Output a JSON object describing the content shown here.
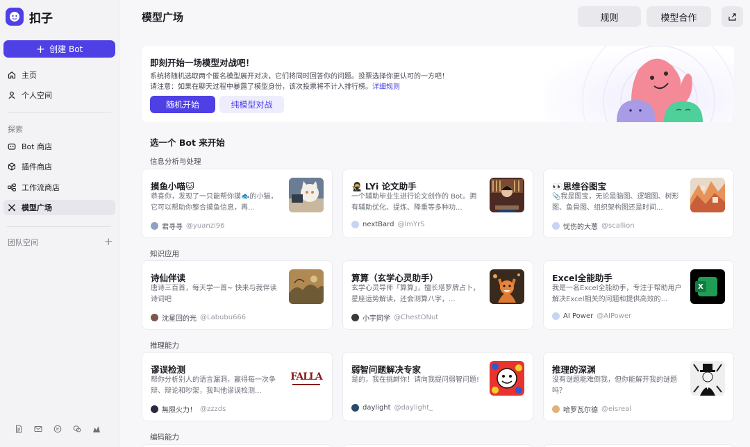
{
  "app": {
    "name": "扣子"
  },
  "sidebar": {
    "create_label": "创建 Bot",
    "nav": [
      {
        "label": "主页",
        "icon": "home-icon"
      },
      {
        "label": "个人空间",
        "icon": "person-icon"
      }
    ],
    "explore_label": "探索",
    "explore": [
      {
        "label": "Bot 商店",
        "icon": "bot-icon"
      },
      {
        "label": "插件商店",
        "icon": "cube-icon"
      },
      {
        "label": "工作流商店",
        "icon": "workflow-icon"
      },
      {
        "label": "模型广场",
        "icon": "model-arena-icon",
        "active": true
      }
    ],
    "team_label": "团队空间"
  },
  "header": {
    "title": "模型广场",
    "rules_label": "规则",
    "cooperation_label": "模型合作"
  },
  "banner": {
    "title": "即刻开始一场模型对战吧！",
    "line1": "系统将随机选取两个匿名模型展开对决，它们将同时回答你的问题。投票选择你更认可的一方吧！",
    "line2": "请注意：如果在聊天过程中暴露了模型身份，该次投票将不计入排行榜。",
    "link": "详细规则",
    "primary_btn": "随机开始",
    "secondary_btn": "纯模型对战"
  },
  "pick_title": "选一个 Bot 来开始",
  "categories": [
    {
      "name": "信息分析与处理",
      "cards": [
        {
          "title": "摸鱼小喵🐱",
          "desc": "恭喜你，发现了一只能帮你摸🐟的小猫，它可以帮助你整合摸鱼信息，再...",
          "author": "君寻寻",
          "handle": "@yuanzi96"
        },
        {
          "title": "🥷 LYi 论文助手",
          "desc": "一个辅助毕业生进行论文创作的 Bot。拥有辅助优化、提炼、降重等多种功...",
          "author": "nextBard",
          "handle": "@lmYrS"
        },
        {
          "title": "👀思维谷图宝",
          "desc": "📎我是图宝，无论是脑图、逻辑图、树形图、鱼骨图、组织架构图还是时间...",
          "author": "忧伤的大葱",
          "handle": "@scallion"
        }
      ]
    },
    {
      "name": "知识应用",
      "cards": [
        {
          "title": "诗仙伴读",
          "desc": "唐诗三百首，每天学一首~ 快来与我伴读诗词吧",
          "author": "沈星回的光",
          "handle": "@Labubu666"
        },
        {
          "title": "算算（玄学心灵助手）",
          "desc": "玄学心灵导师「算算」，擅长塔罗牌占卜，星座运势解读，还会测算八字，...",
          "author": "小宇同学",
          "handle": "@ChestONut"
        },
        {
          "title": "Excel全能助手",
          "desc": "我是一名Excel全能助手，专注于帮助用户解决Excel相关的问题和提供高效的...",
          "author": "AI Power",
          "handle": "@AIPower"
        }
      ]
    },
    {
      "name": "推理能力",
      "cards": [
        {
          "title": "谬误检测",
          "desc": "帮你分析别人的语言漏洞，赢得每一次争辩、辩论和吵架，我叫他谬误检测...",
          "author": "無限火力！",
          "handle": "@zzzds"
        },
        {
          "title": "弱智问题解决专家",
          "desc": "是的，我在挑衅你！请向我提问弱智问题!",
          "author": "daylight",
          "handle": "@daylight_"
        },
        {
          "title": "推理的深渊",
          "desc": "没有谜题能难倒我，但你能解开我的谜题吗？",
          "author": "哈罗瓦尔德",
          "handle": "@eisreal"
        }
      ]
    },
    {
      "name": "编码能力",
      "cards": []
    }
  ],
  "thumbs": {
    "fallacy_text": "FALLA",
    "excel_letter": "X"
  },
  "colors": {
    "accent": "#4e40e5",
    "card_bg": "#ffffff",
    "page_bg": "#f7f7f9"
  }
}
